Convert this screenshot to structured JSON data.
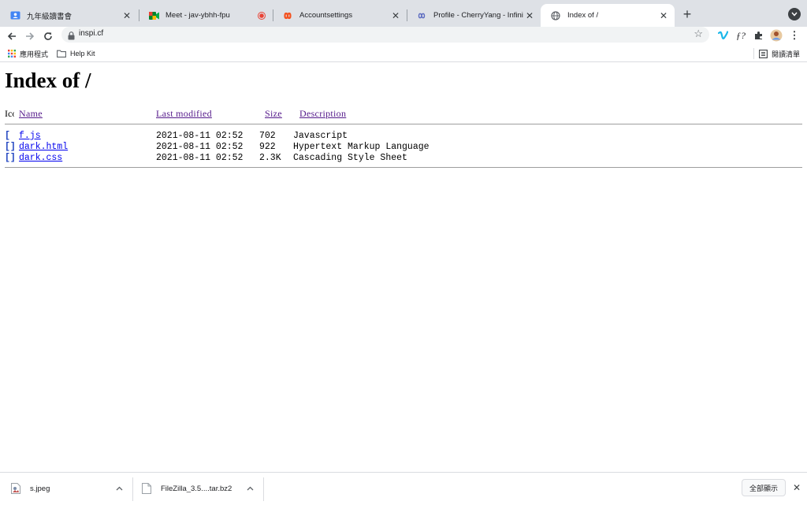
{
  "tabs": [
    {
      "title": "九年級讀書會",
      "icon": "contact-card-icon"
    },
    {
      "title": "Meet - jav-ybhh-fpu",
      "icon": "google-meet-icon",
      "recording": true
    },
    {
      "title": "Accountsettings",
      "icon": "infinity-logo-icon"
    },
    {
      "title": "Profile - CherryYang - InfinityFree",
      "icon": "infinity-loop-icon"
    },
    {
      "title": "Index of /",
      "icon": "globe-icon",
      "active": true
    }
  ],
  "toolbar": {
    "url": "inspi.cf"
  },
  "bookmarks": {
    "apps_label": "應用程式",
    "helpkit_label": "Help Kit",
    "reading_list_label": "閱讀清單"
  },
  "page": {
    "heading": "Index of /",
    "columns": {
      "icon": "Icon",
      "name": "Name",
      "modified": "Last modified",
      "size": "Size",
      "description": "Description"
    },
    "files": [
      {
        "name": "f.js",
        "modified": "2021-08-11 02:52",
        "size": "702",
        "description": "Javascript"
      },
      {
        "name": "dark.html",
        "modified": "2021-08-11 02:52",
        "size": "922",
        "description": "Hypertext Markup Language"
      },
      {
        "name": "dark.css",
        "modified": "2021-08-11 02:52",
        "size": "2.3K",
        "description": "Cascading Style Sheet"
      }
    ]
  },
  "downloads": {
    "items": [
      {
        "name": "s.jpeg"
      },
      {
        "name": "FileZilla_3.5....tar.bz2"
      }
    ],
    "show_all_label": "全部顯示"
  },
  "colors": {
    "tabstrip_bg": "#dee1e6",
    "link_visited": "#551a8b",
    "link": "#0000ee",
    "recording_red": "#ea4335",
    "vimeo_blue": "#1ab7ea"
  }
}
